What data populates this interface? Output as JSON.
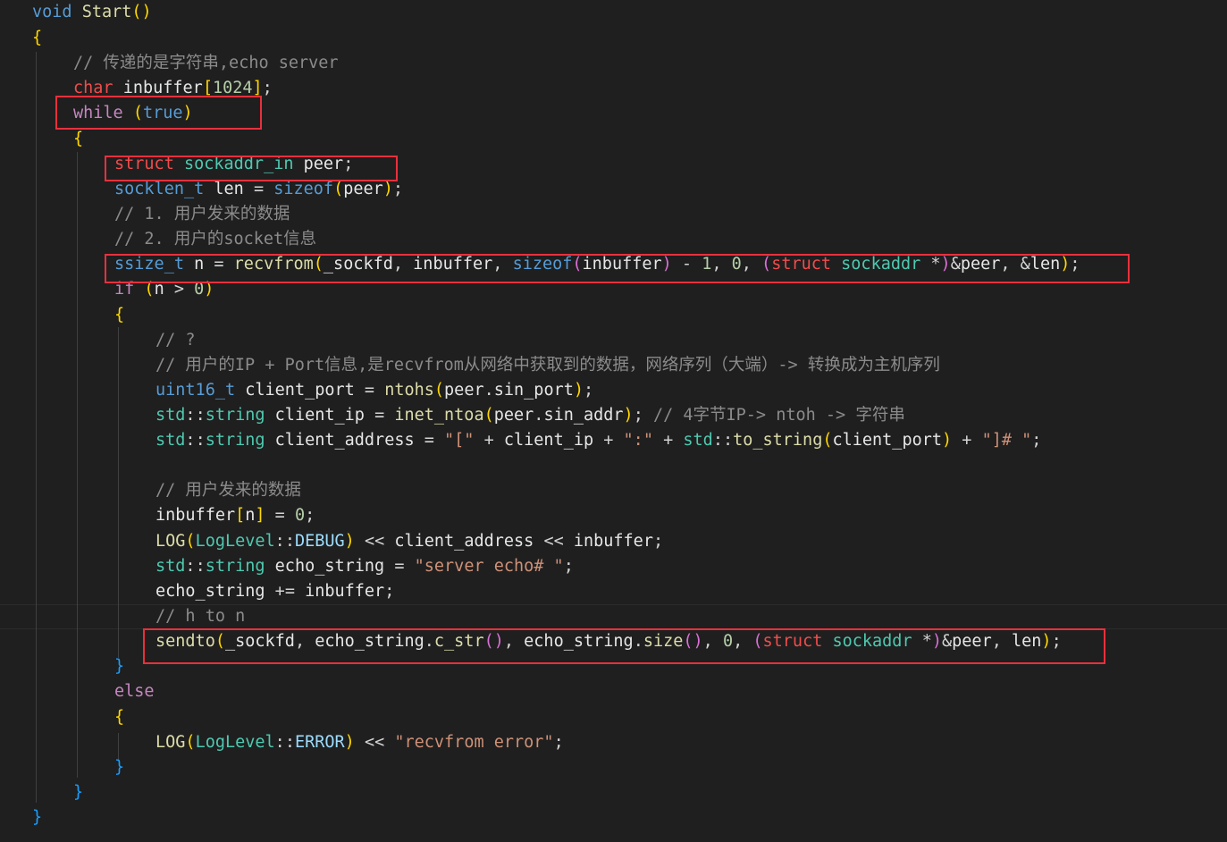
{
  "code": {
    "lines": [
      "void Start()",
      "{",
      "// 传递的是字符串,echo server",
      "char inbuffer[1024];",
      "while (true)",
      "{",
      "struct sockaddr_in peer;",
      "socklen_t len = sizeof(peer);",
      "// 1. 用户发来的数据",
      "// 2. 用户的socket信息",
      "ssize_t n = recvfrom(_sockfd, inbuffer, sizeof(inbuffer) - 1, 0, (struct sockaddr *)&peer, &len);",
      "if (n > 0)",
      "{",
      "// ?",
      "// 用户的IP + Port信息,是recvfrom从网络中获取到的数据，网络序列（大端）-> 转换成为主机序列",
      "uint16_t client_port = ntohs(peer.sin_port);",
      "std::string client_ip = inet_ntoa(peer.sin_addr); // 4字节IP-> ntoh -> 字符串",
      "std::string client_address = \"[\" + client_ip + \":\" + std::to_string(client_port) + \"]# \";",
      "",
      "// 用户发来的数据",
      "inbuffer[n] = 0;",
      "LOG(LogLevel::DEBUG) << client_address << inbuffer;",
      "std::string echo_string = \"server echo# \";",
      "echo_string += inbuffer;",
      "// h to n",
      "sendto(_sockfd, echo_string.c_str(), echo_string.size(), 0, (struct sockaddr *)&peer, len);",
      "}",
      "else",
      "{",
      "LOG(LogLevel::ERROR) << \"recvfrom error\";",
      "}",
      "}",
      "}"
    ]
  },
  "colors": {
    "background": "#1f1f1f",
    "highlight_box": "#e8303c"
  }
}
